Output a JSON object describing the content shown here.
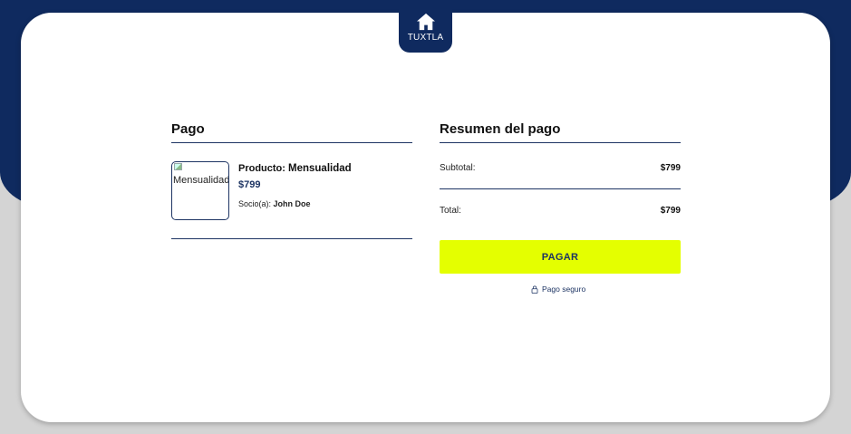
{
  "header": {
    "home_label": "TUXTLA",
    "home_icon": "home-icon"
  },
  "payment": {
    "title": "Pago",
    "product": {
      "image_alt": "Mensualidad",
      "name_prefix": "Producto:",
      "name": "Mensualidad",
      "price": "$799",
      "member_prefix": "Socio(a):",
      "member_name": "John Doe"
    }
  },
  "summary": {
    "title": "Resumen del pago",
    "subtotal_label": "Subtotal:",
    "subtotal_value": "$799",
    "total_label": "Total:",
    "total_value": "$799",
    "pay_button": "PAGAR",
    "secure_label": "Pago seguro",
    "secure_icon": "lock-icon"
  },
  "colors": {
    "brand_navy": "#0f2a5f",
    "accent_yellow": "#e4ff00",
    "background_gray": "#d4d4d4"
  }
}
